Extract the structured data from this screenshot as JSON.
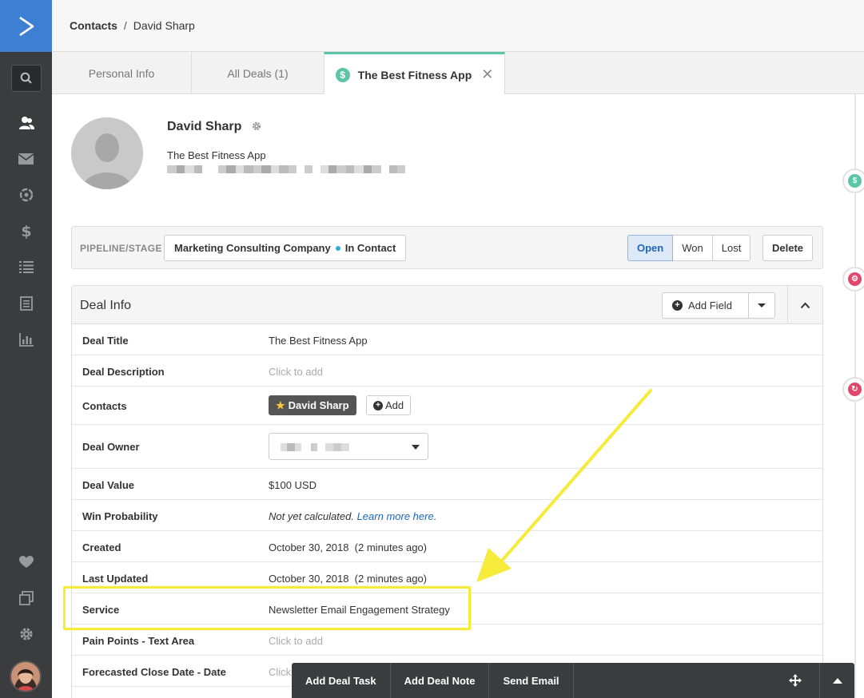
{
  "breadcrumb": {
    "root": "Contacts",
    "separator": "/",
    "current": "David Sharp"
  },
  "tabs": [
    {
      "label": "Personal Info"
    },
    {
      "label": "All Deals (1)"
    },
    {
      "label": "The Best Fitness App",
      "icon": "dollar-icon"
    }
  ],
  "profile": {
    "name": "David Sharp",
    "company": "The Best Fitness App"
  },
  "pipeline": {
    "label": "PIPELINE/STAGE",
    "pipeline_name": "Marketing Consulting Company",
    "stage": "In Contact",
    "stage_color": "#2fa9e0"
  },
  "status_buttons": {
    "open": "Open",
    "won": "Won",
    "lost": "Lost",
    "delete": "Delete"
  },
  "deal_info": {
    "title": "Deal Info",
    "add_field": "Add Field",
    "rows": {
      "deal_title": {
        "label": "Deal Title",
        "value": "The Best Fitness App"
      },
      "deal_description": {
        "label": "Deal Description",
        "value": "Click to add"
      },
      "contacts": {
        "label": "Contacts",
        "contact": "David Sharp",
        "add": "Add"
      },
      "deal_owner": {
        "label": "Deal Owner"
      },
      "deal_value": {
        "label": "Deal Value",
        "value": "$100 USD"
      },
      "win_probability": {
        "label": "Win Probability",
        "value": "Not yet calculated.",
        "link": "Learn more here."
      },
      "created": {
        "label": "Created",
        "value": "October 30, 2018  (2 minutes ago)"
      },
      "last_updated": {
        "label": "Last Updated",
        "value": "October 30, 2018  (2 minutes ago)"
      },
      "service": {
        "label": "Service",
        "value": "Newsletter Email Engagement Strategy"
      },
      "pain_points": {
        "label": "Pain Points - Text Area",
        "value": "Click to add"
      },
      "forecasted_close": {
        "label": "Forecasted Close Date - Date",
        "value": "Click"
      }
    }
  },
  "bottom_bar": {
    "add_task": "Add Deal Task",
    "add_note": "Add Deal Note",
    "send_email": "Send Email"
  },
  "colors": {
    "sidebar": "#3a3c3e",
    "logo": "#3d7fd3",
    "accent_green": "#5cc5a7",
    "link_blue": "#2166b9",
    "highlight_yellow": "#f6ea3b",
    "timeline_red": "#e0476a"
  }
}
